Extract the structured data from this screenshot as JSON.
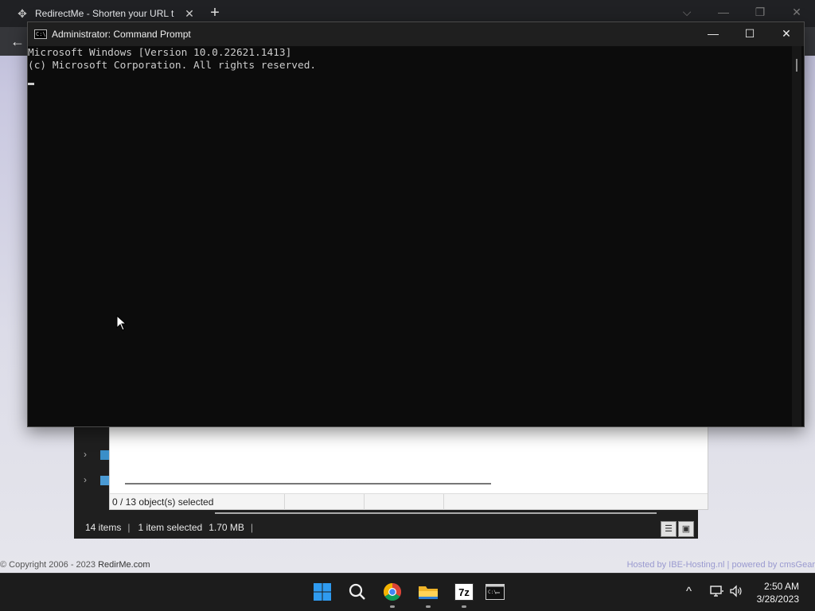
{
  "browser": {
    "tab_title": "RedirectMe - Shorten your URL t",
    "tab_close": "✕",
    "new_tab": "+",
    "back": "←",
    "controls": [
      "⌵",
      "—",
      "❐",
      "✕"
    ],
    "footer_copyright": "© Copyright 2006 - 2023",
    "footer_site": "RedirMe.com",
    "footer_right": "Hosted by IBE-Hosting.nl  |  powered by cmsGear"
  },
  "cmd": {
    "title": "Administrator: Command Prompt",
    "icon_text": "C:\\",
    "minimize": "—",
    "maximize": "☐",
    "close": "✕",
    "lines": [
      "Microsoft Windows [Version 10.0.22621.1413]",
      "(c) Microsoft Corporation. All rights reserved."
    ]
  },
  "panel": {
    "status_selected": "0 / 13 object(s) selected"
  },
  "explorer": {
    "items_count": "14 items",
    "selection": "1 item selected",
    "size": "1.70 MB",
    "nav_arrow": "›"
  },
  "taskbar": {
    "apps": [
      "windows-start",
      "search",
      "chrome",
      "file-explorer",
      "7zip",
      "terminal"
    ],
    "sevenzip_label": "7z",
    "tray_chevron": "^",
    "time": "2:50 AM",
    "date": "3/28/2023"
  },
  "colors": {
    "cmd_bg": "#0c0c0c",
    "cmd_text": "#cccccc",
    "taskbar_bg": "#1c1c1c",
    "windows_blue": "#2f9bf0"
  }
}
